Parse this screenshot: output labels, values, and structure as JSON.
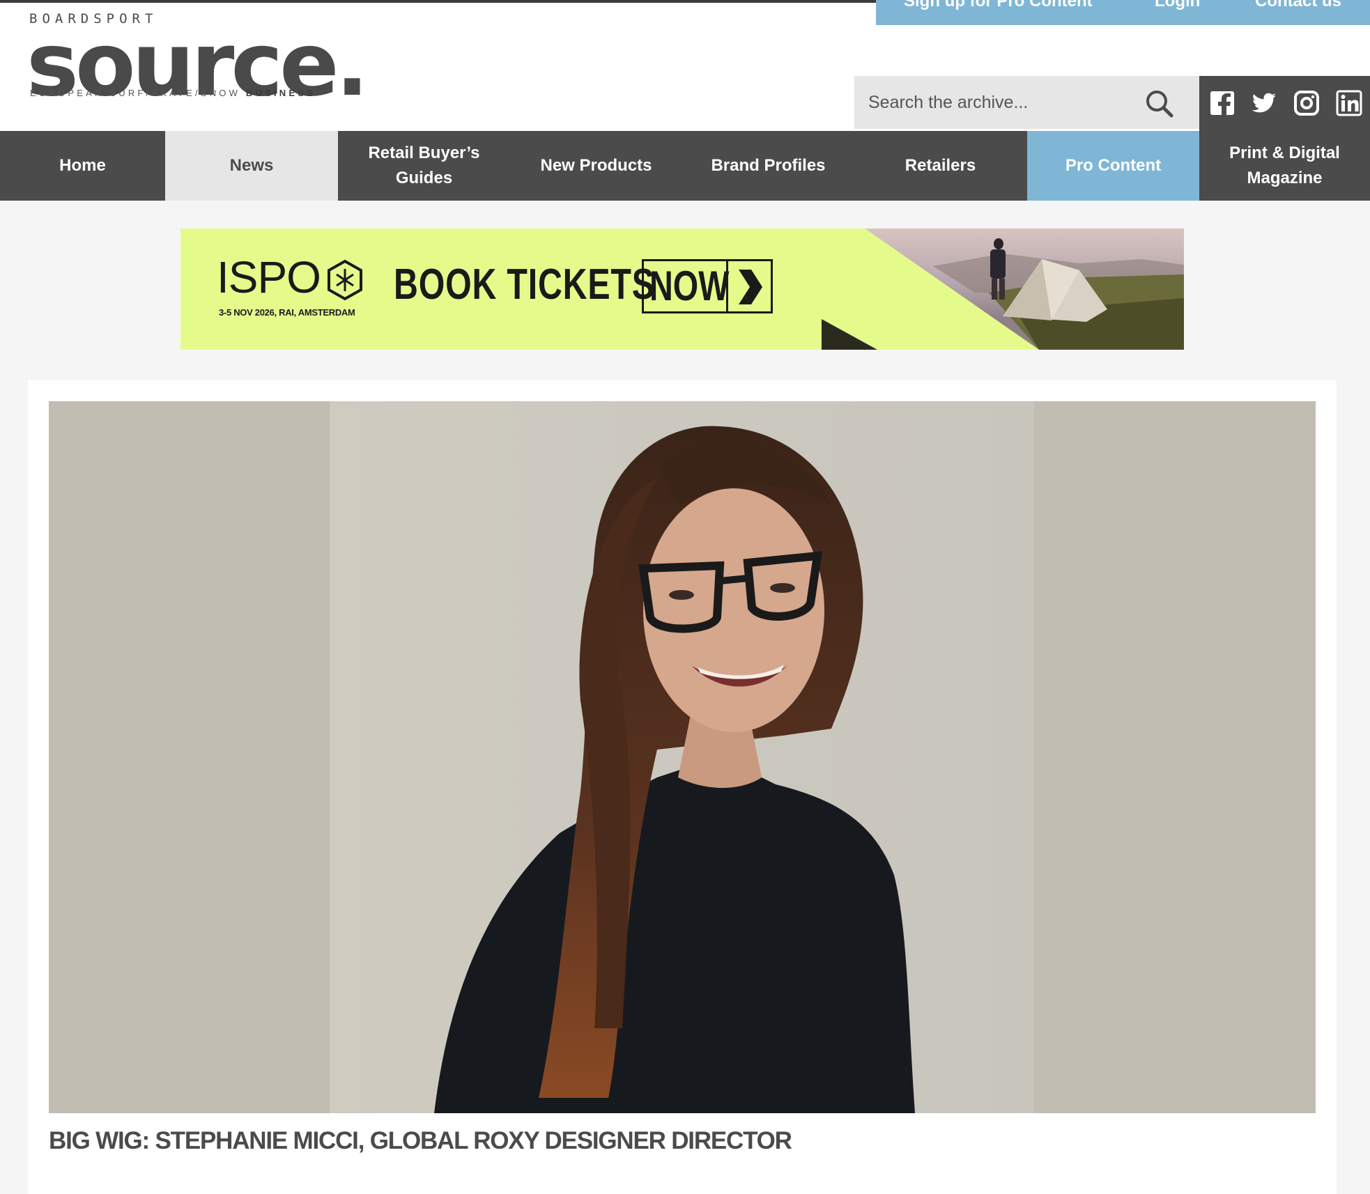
{
  "logo": {
    "top_text": "BOARDSPORT",
    "main_text": "source.",
    "tagline": "EUROPEAN SURF/SKATE/SNOW",
    "tagline_bold": "BUSINESS"
  },
  "top_links": [
    "Sign up for Pro Content",
    "Login",
    "Contact us"
  ],
  "search": {
    "placeholder": "Search the archive..."
  },
  "social": [
    "facebook-icon",
    "twitter-icon",
    "instagram-icon",
    "linkedin-icon"
  ],
  "nav": {
    "items": [
      {
        "label": "Home"
      },
      {
        "label": "News",
        "active": true
      },
      {
        "label": "Retail Buyer’s Guides"
      },
      {
        "label": "New Products"
      },
      {
        "label": "Brand Profiles"
      },
      {
        "label": "Retailers"
      },
      {
        "label": "Pro Content"
      },
      {
        "label": "Print & Digital Magazine"
      }
    ]
  },
  "ad": {
    "brand": "ISPO",
    "date": "3-5 NOV 2026, RAI, AMSTERDAM",
    "headline": "BOOK TICKETS",
    "cta": "NOW"
  },
  "article": {
    "title": "BIG WIG: STEPHANIE MICCI, GLOBAL ROXY DESIGNER DIRECTOR"
  },
  "colors": {
    "nav_bg": "#4b4b4b",
    "accent_blue": "#7fb6d5",
    "active_tab": "#e6e6e6",
    "ad_bg": "#e4fb8c",
    "hero_bg": "#c1bdb2"
  }
}
